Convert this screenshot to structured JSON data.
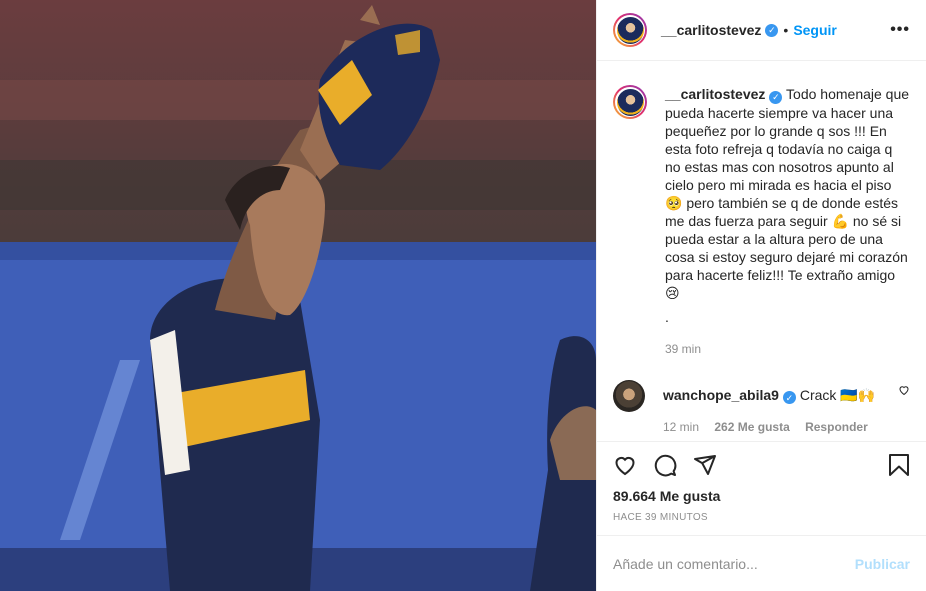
{
  "post": {
    "author": "__carlitostevez",
    "follow_label": "Seguir",
    "more_label": "•••",
    "dot": "•"
  },
  "caption": {
    "author": "__carlitostevez",
    "text": "Todo homenaje que pueda hacerte siempre va hacer una pequeñez por lo grande q sos !!! En esta foto refreja q todavía no caiga q no estas mas con nosotros apunto al cielo pero mi mirada es hacia el piso 🥺 pero también se q de donde estés me das fuerza para seguir 💪 no sé si pueda estar a la altura pero de una cosa si estoy seguro dejaré mi corazón para hacerte feliz!!! Te extraño amigo 😢",
    "extra": ".",
    "time": "39 min"
  },
  "comments": [
    {
      "author": "wanchope_abila9",
      "text": "Crack 🇺🇦🙌",
      "time": "12 min",
      "likes": "262 Me gusta",
      "reply_label": "Responder"
    }
  ],
  "stats": {
    "likes": "89.664 Me gusta",
    "posted": "HACE 39 MINUTOS"
  },
  "composer": {
    "placeholder": "Añade un comentario...",
    "publish_label": "Publicar"
  },
  "colors": {
    "accent": "#0095f6",
    "verified": "#3897f0",
    "muted": "#8e8e8e"
  }
}
